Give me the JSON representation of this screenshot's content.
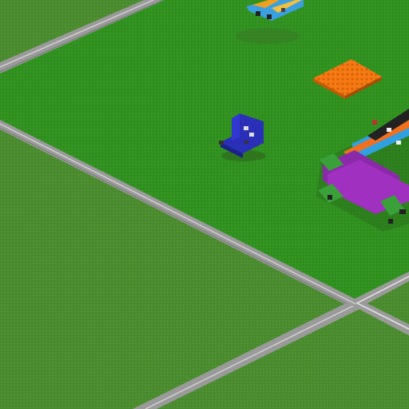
{
  "scene": {
    "type": "isometric voxel building game view",
    "colors": {
      "grass_dark": "#4a8a2e",
      "grass_light": "#2f8f1e",
      "road_gray": "#8c8c8c",
      "road_light": "#c8c8c8",
      "baseplate_orange": "#f57a14",
      "blue_build": "#2a2fb8",
      "purple_build": "#8a2aa8",
      "green_build": "#3aa03a"
    },
    "objects": [
      {
        "name": "orange-baseplate",
        "color": "#f57a14"
      },
      {
        "name": "blue-chair-build",
        "color": "#2a2fb8"
      },
      {
        "name": "multicolor-vehicle-row",
        "color": "#8a2aa8"
      },
      {
        "name": "floating-colorful-build",
        "color": "#3aa0e0"
      }
    ]
  }
}
